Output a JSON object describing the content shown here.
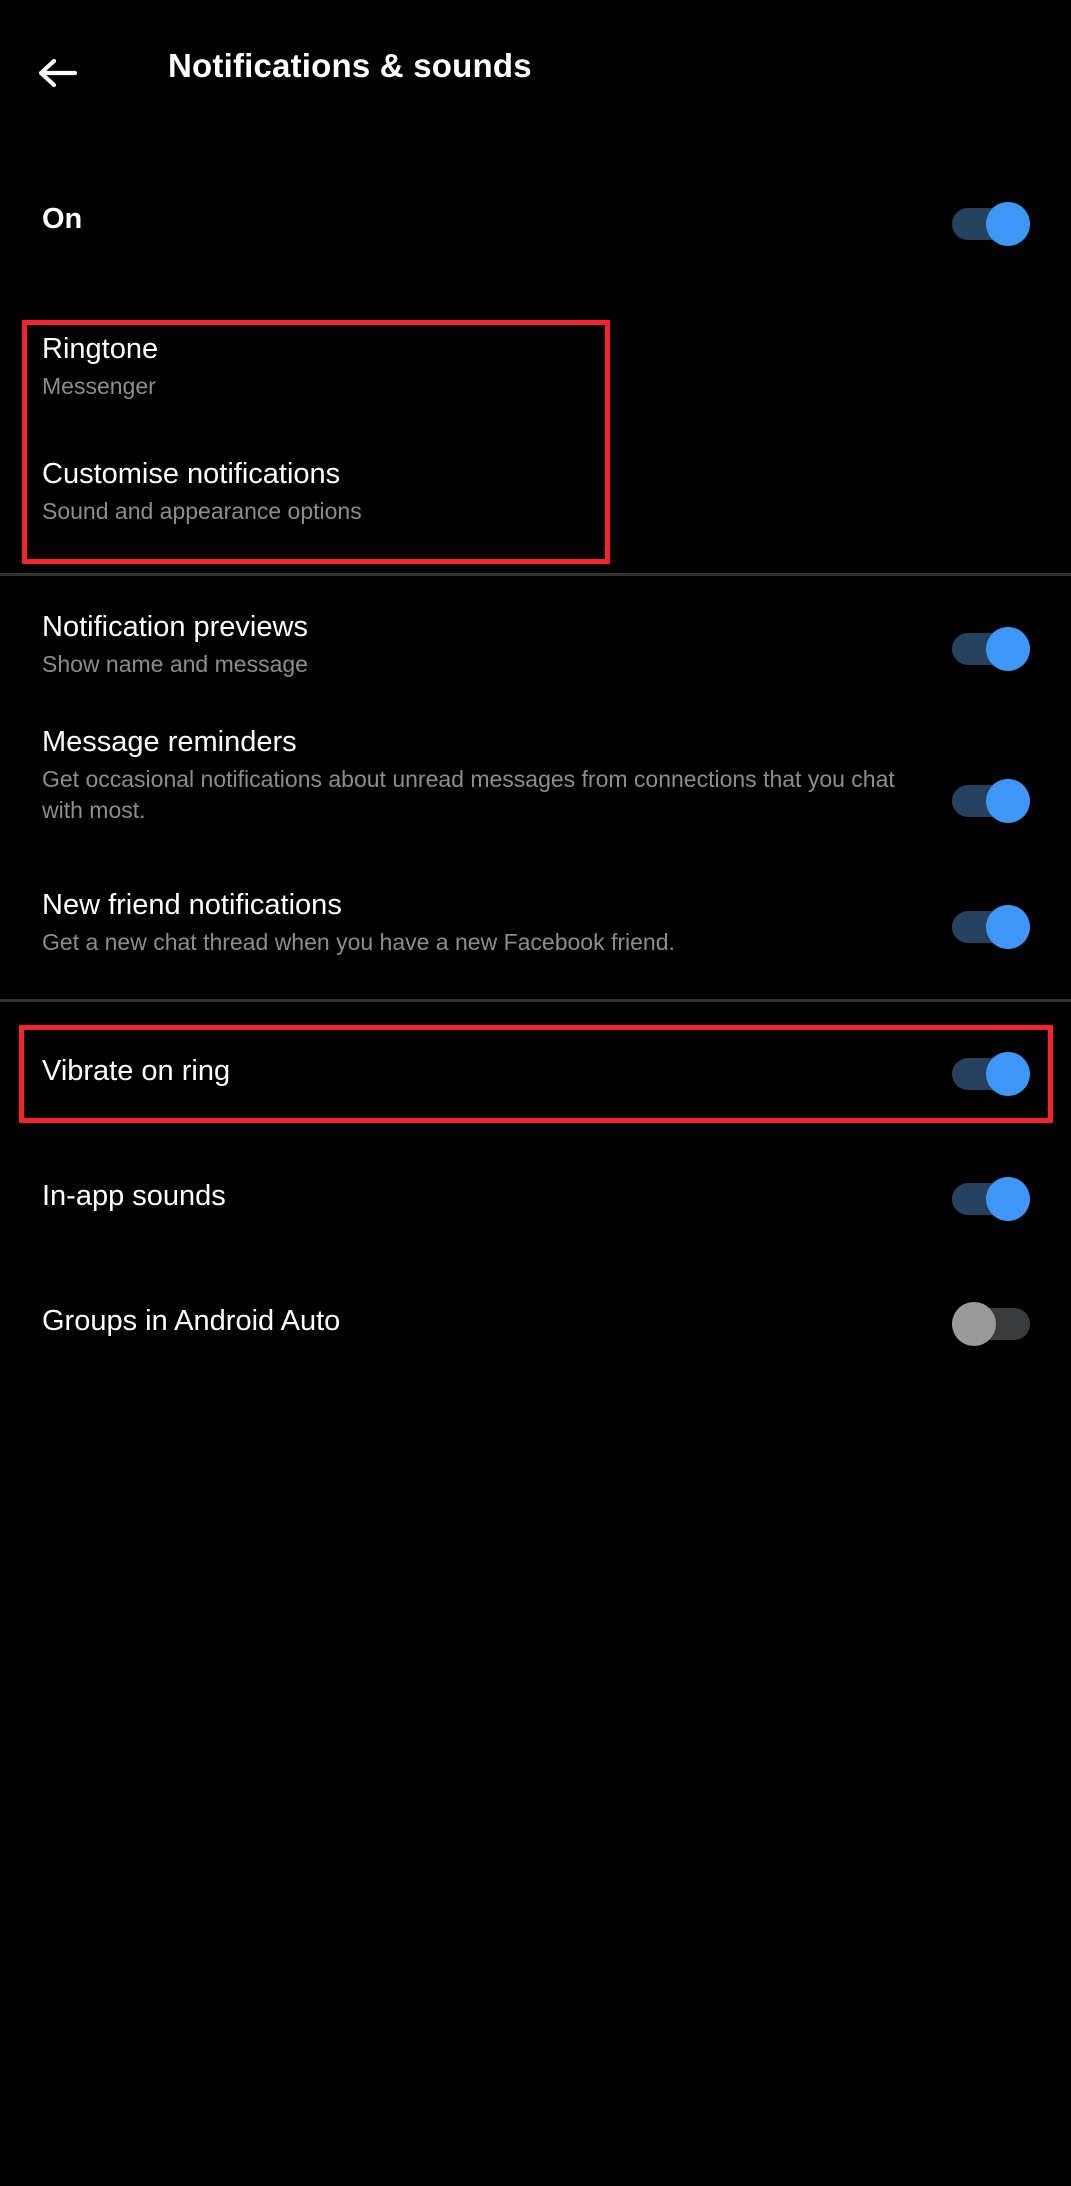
{
  "header": {
    "back_icon": "arrow-left-icon",
    "title": "Notifications & sounds"
  },
  "colors": {
    "background": "#000000",
    "primary_text": "#ffffff",
    "secondary_text": "#8a8d91",
    "toggle_on_thumb": "#3e97f7",
    "toggle_on_track": "#27405e",
    "toggle_off_thumb": "#9a9a9a",
    "toggle_off_track": "#3a3b3c",
    "divider": "#313235",
    "highlight_border": "#f4232e"
  },
  "settings": {
    "master": {
      "label": "On",
      "toggle_state": "on"
    },
    "ringtone": {
      "label": "Ringtone",
      "sublabel": "Messenger"
    },
    "customise": {
      "label": "Customise notifications",
      "sublabel": "Sound and appearance options"
    },
    "previews": {
      "label": "Notification previews",
      "sublabel": "Show name and message",
      "toggle_state": "on"
    },
    "reminders": {
      "label": "Message reminders",
      "sublabel": "Get occasional notifications about unread messages from connections that you chat with most.",
      "toggle_state": "on"
    },
    "new_friend": {
      "label": "New friend notifications",
      "sublabel": "Get a new chat thread when you have a new Facebook friend.",
      "toggle_state": "on"
    },
    "vibrate": {
      "label": "Vibrate on ring",
      "toggle_state": "on"
    },
    "in_app_sounds": {
      "label": "In-app sounds",
      "toggle_state": "on"
    },
    "android_auto": {
      "label": "Groups in Android Auto",
      "toggle_state": "off"
    }
  }
}
